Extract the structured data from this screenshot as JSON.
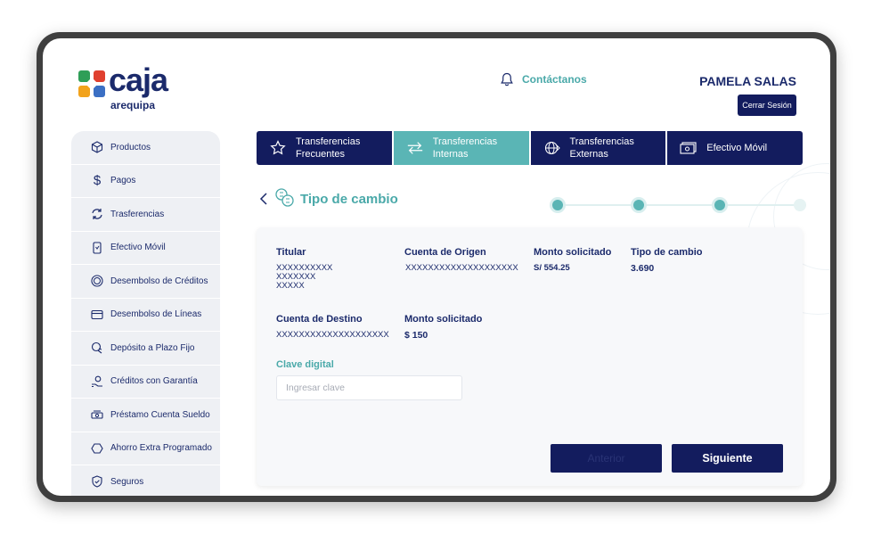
{
  "brand": {
    "name": "caja",
    "subtitle": "arequipa"
  },
  "header": {
    "contact_label": "Contáctanos",
    "user_name": "PAMELA SALAS",
    "logout_label": "Cerrar Sesión"
  },
  "sidebar": {
    "items": [
      {
        "label": "Productos",
        "icon": "cube-icon"
      },
      {
        "label": "Pagos",
        "icon": "dollar-icon"
      },
      {
        "label": "Trasferencias",
        "icon": "refresh-icon"
      },
      {
        "label": "Efectivo Móvil",
        "icon": "mobile-icon"
      },
      {
        "label": "Desembolso de Créditos",
        "icon": "coin-icon"
      },
      {
        "label": "Desembolso de Líneas",
        "icon": "card-icon"
      },
      {
        "label": "Depósito a Plazo Fijo",
        "icon": "piggy-icon"
      },
      {
        "label": "Créditos con Garantía",
        "icon": "hand-icon"
      },
      {
        "label": "Préstamo Cuenta Sueldo",
        "icon": "money-icon"
      },
      {
        "label": "Ahorro Extra Programado",
        "icon": "savings-icon"
      },
      {
        "label": "Seguros",
        "icon": "shield-icon"
      }
    ]
  },
  "tabs": [
    {
      "label_line1": "Transferencias",
      "label_line2": "Frecuentes",
      "icon": "star-icon",
      "active": false
    },
    {
      "label_line1": "Transferencias",
      "label_line2": "Internas",
      "icon": "arrows-icon",
      "active": true
    },
    {
      "label_line1": "Transferencias",
      "label_line2": "Externas",
      "icon": "globe-icon",
      "active": false
    },
    {
      "label_line1": "Efectivo Móvil",
      "label_line2": "",
      "icon": "cash-icon",
      "active": false
    }
  ],
  "section": {
    "title": "Tipo de cambio",
    "steps_total": 4,
    "steps_completed": 3
  },
  "summary": {
    "titular_label": "Titular",
    "titular_value_line1": "XXXXXXXXXX",
    "titular_value_line2": "XXXXXXX",
    "titular_value_line3": "XXXXX",
    "origen_label": "Cuenta de Origen",
    "origen_value": "XXXXXXXXXXXXXXXXXXXX",
    "monto1_label": "Monto solicitado",
    "monto1_value": "S/ 554.25",
    "cambio_label": "Tipo de cambio",
    "cambio_value": "3.690",
    "destino_label": "Cuenta de Destino",
    "destino_value": "XXXXXXXXXXXXXXXXXXXX",
    "monto2_label": "Monto solicitado",
    "monto2_value": "$ 150"
  },
  "form": {
    "clave_label": "Clave digital",
    "clave_placeholder": "Ingresar clave",
    "clave_value": ""
  },
  "actions": {
    "cancel_label": "Anterior",
    "next_label": "Siguiente"
  },
  "colors": {
    "navy": "#131c5e",
    "brand_text": "#1b2a6b",
    "teal": "#5ab5b5",
    "teal_text": "#4aa9a9",
    "sidebar_bg": "#eef0f4"
  }
}
